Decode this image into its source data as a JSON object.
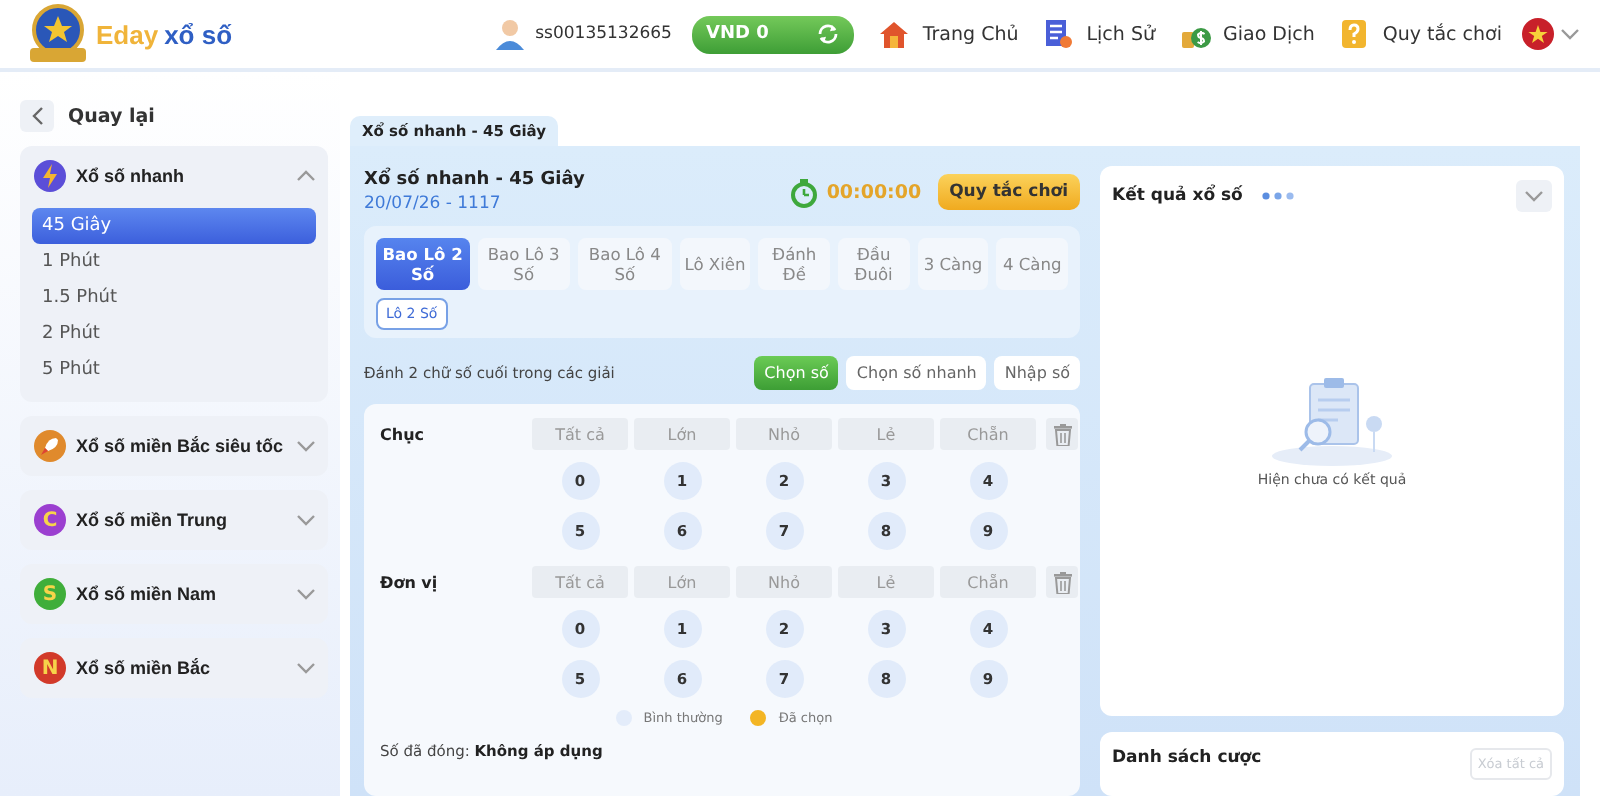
{
  "header": {
    "logo": {
      "brand_a": "Eday",
      "brand_b": "xổ số"
    },
    "user": {
      "name": "ss00135132665"
    },
    "balance": {
      "label": "VND 0"
    },
    "nav": [
      {
        "label": "Trang Chủ",
        "kind": "house"
      },
      {
        "label": "Lịch Sử",
        "kind": "document"
      },
      {
        "label": "Giao Dịch",
        "kind": "money"
      },
      {
        "label": "Quy tắc chơi",
        "kind": "question"
      }
    ]
  },
  "sidebar": {
    "back": "Quay lại",
    "groups": [
      {
        "title": "Xổ số nhanh",
        "kind": "bolt",
        "color": "#5b4ed8",
        "expanded": true,
        "children": [
          {
            "label": "45 Giây",
            "selected": true
          },
          {
            "label": "1 Phút",
            "selected": false
          },
          {
            "label": "1.5 Phút",
            "selected": false
          },
          {
            "label": "2 Phút",
            "selected": false
          },
          {
            "label": "5 Phút",
            "selected": false
          }
        ]
      },
      {
        "title": "Xổ số miền Bắc siêu tốc",
        "kind": "rocket",
        "color": "#e08a2c",
        "expanded": false
      },
      {
        "title": "Xổ số miền Trung",
        "kind": "letter",
        "letter": "C",
        "color": "#9b3fd0",
        "expanded": false
      },
      {
        "title": "Xổ số miền Nam",
        "kind": "letter",
        "letter": "S",
        "color": "#3fae3a",
        "expanded": false
      },
      {
        "title": "Xổ số miền Bắc",
        "kind": "letter",
        "letter": "N",
        "color": "#d23a2a",
        "expanded": false
      }
    ]
  },
  "tabs": [
    {
      "label": "Xổ số nhanh - 45 Giây",
      "selected": true
    }
  ],
  "game": {
    "title": "Xổ số nhanh - 45 Giây",
    "draw": "20/07/26 - 1117",
    "timer": "00:00:00",
    "rules_button": "Quy tắc chơi"
  },
  "bet_types": [
    {
      "label": "Bao Lô 2 Số",
      "selected": true
    },
    {
      "label": "Bao Lô 3 Số",
      "selected": false
    },
    {
      "label": "Bao Lô 4 Số",
      "selected": false
    },
    {
      "label": "Lô Xiên",
      "selected": false
    },
    {
      "label": "Đánh Đề",
      "selected": false
    },
    {
      "label": "Đầu Đuôi",
      "selected": false
    },
    {
      "label": "3 Càng",
      "selected": false
    },
    {
      "label": "4 Càng",
      "selected": false
    }
  ],
  "sub_types": [
    {
      "label": "Lô 2 Số",
      "selected": true
    }
  ],
  "instruction": "Đánh 2 chữ số cuối trong các giải",
  "modes": [
    {
      "label": "Chọn số",
      "selected": true
    },
    {
      "label": "Chọn số nhanh",
      "selected": false
    },
    {
      "label": "Nhập số",
      "selected": false
    }
  ],
  "rows": [
    {
      "label": "Chục",
      "filters": [
        "Tất cả",
        "Lớn",
        "Nhỏ",
        "Lẻ",
        "Chẵn"
      ],
      "digits": [
        {
          "label": "0",
          "selected": false
        },
        {
          "label": "1",
          "selected": false
        },
        {
          "label": "2",
          "selected": false
        },
        {
          "label": "3",
          "selected": false
        },
        {
          "label": "4",
          "selected": false
        },
        {
          "label": "5",
          "selected": false
        },
        {
          "label": "6",
          "selected": false
        },
        {
          "label": "7",
          "selected": false
        },
        {
          "label": "8",
          "selected": false
        },
        {
          "label": "9",
          "selected": false
        }
      ]
    },
    {
      "label": "Đơn vị",
      "filters": [
        "Tất cả",
        "Lớn",
        "Nhỏ",
        "Lẻ",
        "Chẵn"
      ],
      "digits": [
        {
          "label": "0",
          "selected": false
        },
        {
          "label": "1",
          "selected": false
        },
        {
          "label": "2",
          "selected": false
        },
        {
          "label": "3",
          "selected": false
        },
        {
          "label": "4",
          "selected": false
        },
        {
          "label": "5",
          "selected": false
        },
        {
          "label": "6",
          "selected": false
        },
        {
          "label": "7",
          "selected": false
        },
        {
          "label": "8",
          "selected": false
        },
        {
          "label": "9",
          "selected": false
        }
      ]
    }
  ],
  "legend": [
    {
      "label": "Bình thường",
      "kind": "normal"
    },
    {
      "label": "Đã chọn",
      "kind": "chosen"
    }
  ],
  "closed_numbers": {
    "label": "Số đã đóng:",
    "value": "Không áp dụng"
  },
  "results": {
    "title": "Kết quả xổ số",
    "empty": "Hiện chưa có kết quả"
  },
  "bet_list": {
    "title": "Danh sách cược",
    "clear_button": "Xóa tất cả",
    "clear_disabled": true
  }
}
